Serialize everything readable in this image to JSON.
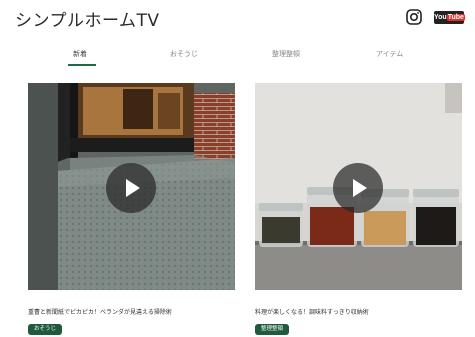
{
  "header": {
    "site_title": "シンプルホームTV",
    "icons": [
      "instagram-icon",
      "youtube-icon"
    ],
    "youtube_badge": {
      "you": "You",
      "tube": "Tube"
    }
  },
  "tabs": [
    {
      "label": "新着",
      "active": true
    },
    {
      "label": "おそうじ",
      "active": false
    },
    {
      "label": "整理整頓",
      "active": false
    },
    {
      "label": "アイテム",
      "active": false
    }
  ],
  "videos": [
    {
      "title": "重曹と新聞紙でピカピカ！ベランダが見違える掃除術",
      "tag": "おそうじ"
    },
    {
      "title": "料理が楽しくなる！調味料すっきり収納術",
      "tag": "整理整頓"
    }
  ],
  "colors": {
    "accent": "#1f6b47",
    "tag_bg": "#1f5a3e",
    "play_overlay": "#282828"
  }
}
